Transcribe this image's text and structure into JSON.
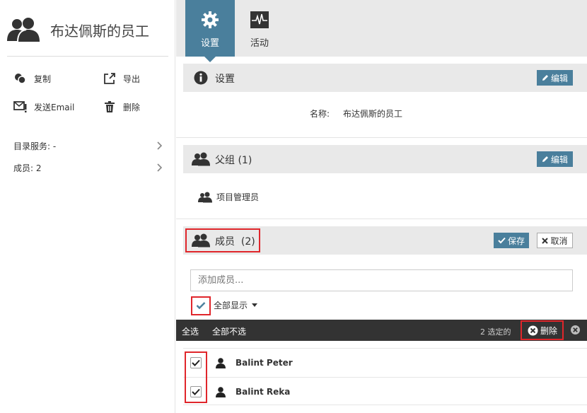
{
  "sidebar": {
    "title": "布达佩斯的员工",
    "actions": {
      "copy": "复制",
      "export": "导出",
      "send_email": "发送Email",
      "delete": "删除"
    },
    "rows": [
      {
        "label": "目录服务: -"
      },
      {
        "label": "成员: 2"
      }
    ]
  },
  "tabs": [
    {
      "label": "设置",
      "icon": "gear-icon",
      "active": true
    },
    {
      "label": "活动",
      "icon": "activity-icon",
      "active": false
    }
  ],
  "settings_section": {
    "title": "设置",
    "edit_label": "编辑",
    "name_label": "名称:",
    "name_value": "布达佩斯的员工"
  },
  "parent_section": {
    "title": "父组 (1)",
    "edit_label": "编辑",
    "items": [
      "项目管理员"
    ]
  },
  "members_section": {
    "title": "成员",
    "count": "(2)",
    "save_label": "保存",
    "cancel_label": "取消",
    "add_placeholder": "添加成员...",
    "show_all_label": "全部显示",
    "toolbar": {
      "select_all": "全选",
      "select_none": "全部不选",
      "selected_count": "2 选定的",
      "delete_label": "删除"
    },
    "members": [
      {
        "name": "Balint Peter",
        "checked": true
      },
      {
        "name": "Balint Reka",
        "checked": true
      }
    ]
  },
  "colors": {
    "accent": "#4a7f9c",
    "toolbar_bg": "#333333",
    "highlight": "#e0262b"
  }
}
